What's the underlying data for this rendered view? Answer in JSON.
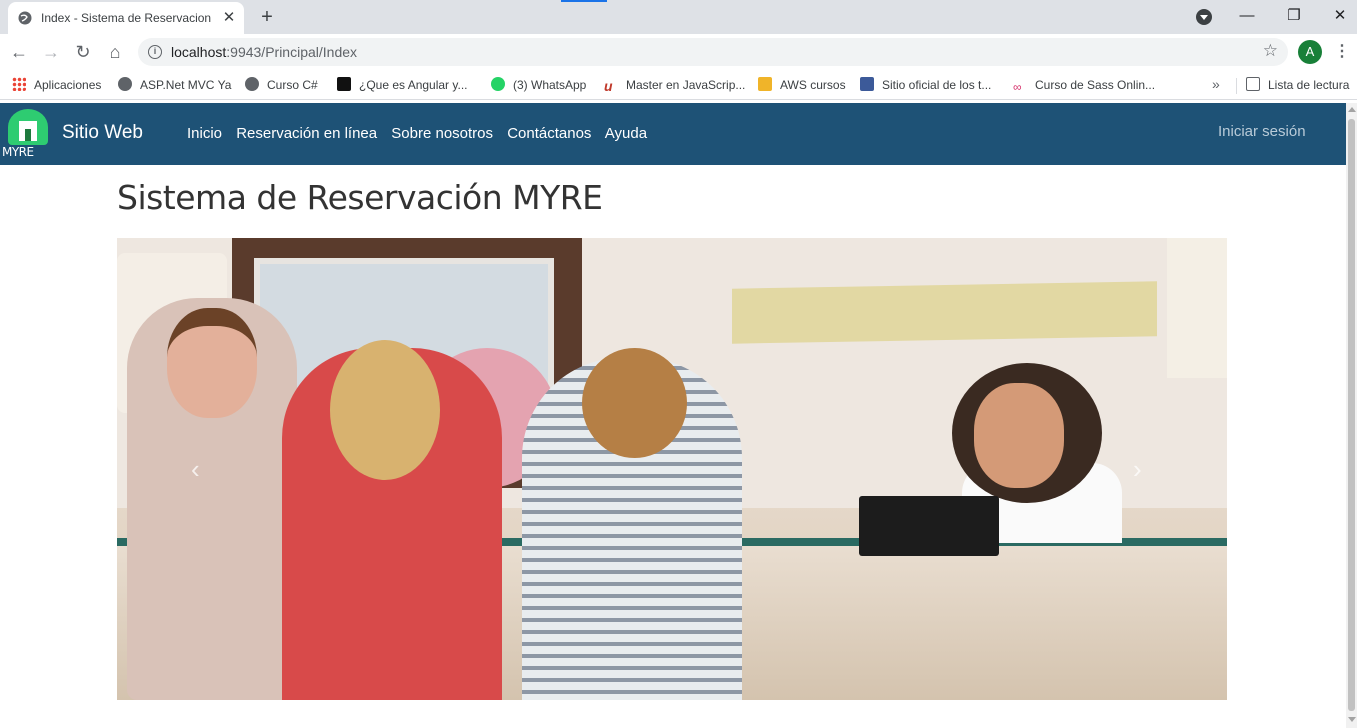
{
  "browser": {
    "tab_title": "Index - Sistema de Reservacion M",
    "tab_close": "✕",
    "new_tab": "+",
    "window_minimize": "—",
    "window_restore": "❐",
    "window_close": "✕",
    "back": "←",
    "forward": "→",
    "reload": "↻",
    "home": "⌂",
    "url_host": "localhost",
    "url_rest": ":9943/Principal/Index",
    "bookmark_star": "☆",
    "profile_initial": "A",
    "menu": "⋮",
    "bookmarks": [
      {
        "label": "Aplicaciones",
        "icon": "apps-grid-icon"
      },
      {
        "label": "ASP.Net MVC Ya",
        "icon": "globe-icon"
      },
      {
        "label": "Curso C#",
        "icon": "globe-icon"
      },
      {
        "label": "¿Que es Angular y...",
        "icon": "mv-icon"
      },
      {
        "label": "(3) WhatsApp",
        "icon": "whatsapp-icon"
      },
      {
        "label": "Master en JavaScrip...",
        "icon": "udemy-icon"
      },
      {
        "label": "AWS cursos",
        "icon": "aws-icon"
      },
      {
        "label": "Sitio oficial de los t...",
        "icon": "jw-icon"
      },
      {
        "label": "Curso de Sass Onlin...",
        "icon": "sass-icon"
      }
    ],
    "bookmarks_more": "»",
    "reading_list": "Lista de lectura"
  },
  "site": {
    "brand_text": "MYRE",
    "name": "Sitio Web",
    "menu": [
      "Inicio",
      "Reservación en línea",
      "Sobre nosotros",
      "Contáctanos",
      "Ayuda"
    ],
    "login": "Iniciar sesión",
    "page_heading": "Sistema de Reservación MYRE",
    "carousel_prev": "‹",
    "carousel_next": "›"
  },
  "colors": {
    "navbar": "#1e5276",
    "tabstrip": "#dee1e6",
    "logo_green": "#2ecc71"
  }
}
